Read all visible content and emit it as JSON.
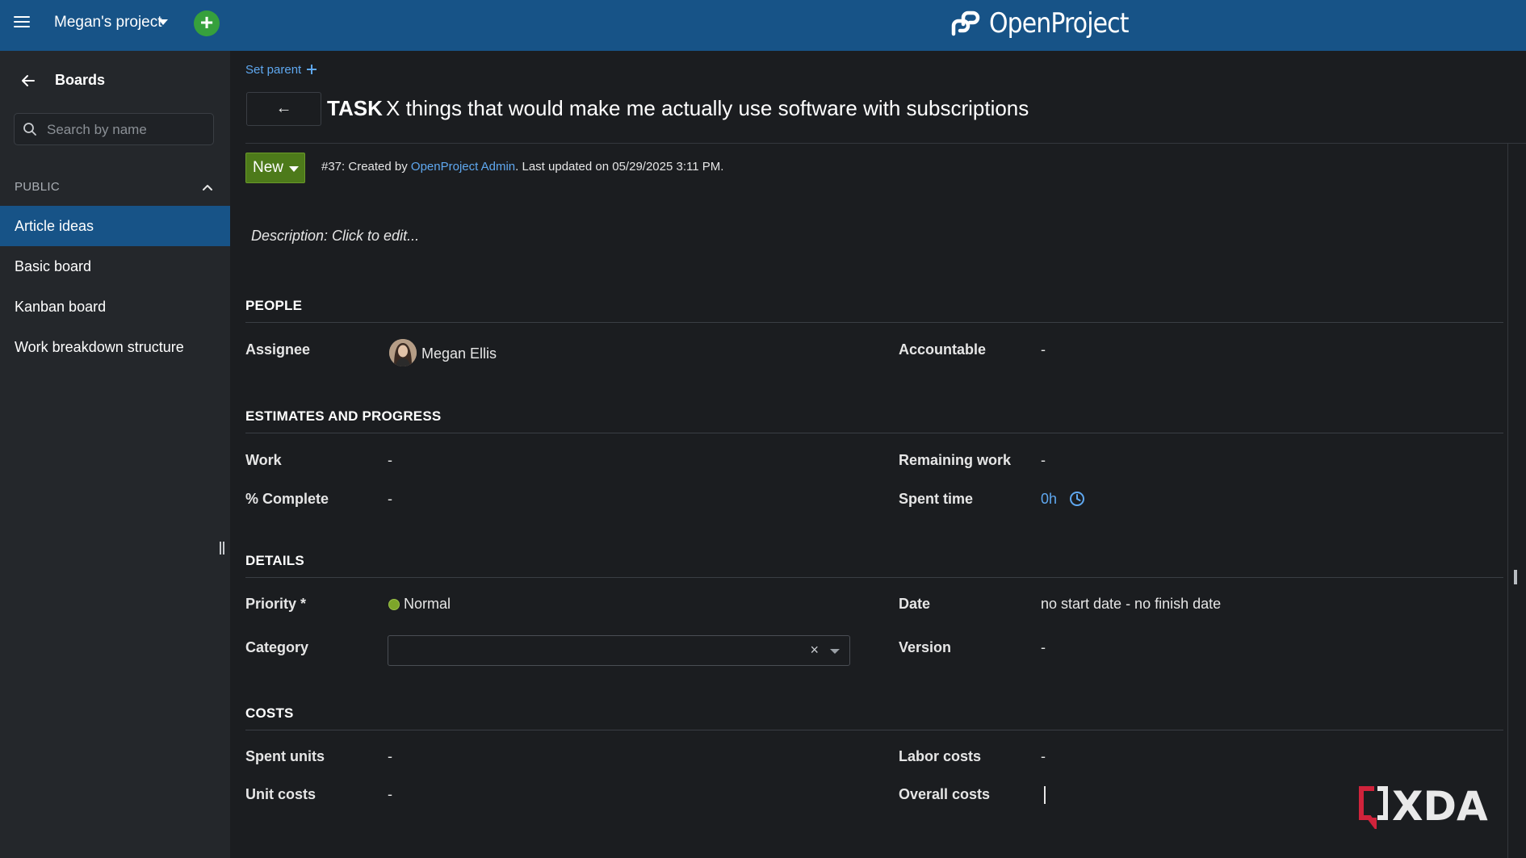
{
  "header": {
    "project_name": "Megan's project",
    "add_label": "+",
    "logo_text": "OpenProject"
  },
  "sidebar": {
    "back_icon": "arrow-left-icon",
    "title": "Boards",
    "search_placeholder": "Search by name",
    "section_label": "PUBLIC",
    "items": [
      {
        "label": "Article ideas",
        "active": true
      },
      {
        "label": "Basic board",
        "active": false
      },
      {
        "label": "Kanban board",
        "active": false
      },
      {
        "label": "Work breakdown structure",
        "active": false
      }
    ]
  },
  "work_package": {
    "set_parent_label": "Set parent",
    "back_label": "←",
    "type": "TASK",
    "subject": "X things that would make me actually use software with subscriptions",
    "status": "New",
    "status_color": "#4d7a1a",
    "meta_prefix": "#37: Created by ",
    "meta_author": "OpenProject Admin",
    "meta_suffix": ". Last updated on 05/29/2025 3:11 PM.",
    "description_placeholder": "Description: Click to edit..."
  },
  "groups": {
    "people": {
      "title": "PEOPLE",
      "assignee_label": "Assignee",
      "assignee_value": "Megan Ellis",
      "accountable_label": "Accountable",
      "accountable_value": "-"
    },
    "estimates": {
      "title": "ESTIMATES AND PROGRESS",
      "work_label": "Work",
      "work_value": "-",
      "remaining_label": "Remaining work",
      "remaining_value": "-",
      "complete_label": "% Complete",
      "complete_value": "-",
      "spent_label": "Spent time",
      "spent_value": "0h"
    },
    "details": {
      "title": "DETAILS",
      "priority_label": "Priority *",
      "priority_value": "Normal",
      "date_label": "Date",
      "date_value": "no start date - no finish date",
      "category_label": "Category",
      "version_label": "Version",
      "version_value": "-"
    },
    "costs": {
      "title": "COSTS",
      "spent_units_label": "Spent units",
      "spent_units_value": "-",
      "labor_label": "Labor costs",
      "labor_value": "-",
      "unit_costs_label": "Unit costs",
      "unit_costs_value": "-",
      "overall_label": "Overall costs",
      "overall_value": ""
    }
  },
  "watermark": {
    "text": "XDA"
  },
  "colors": {
    "header_bg": "#175387",
    "link": "#5fa8f0",
    "accent_green": "#36a03c",
    "priority_normal": "#7da62a"
  }
}
